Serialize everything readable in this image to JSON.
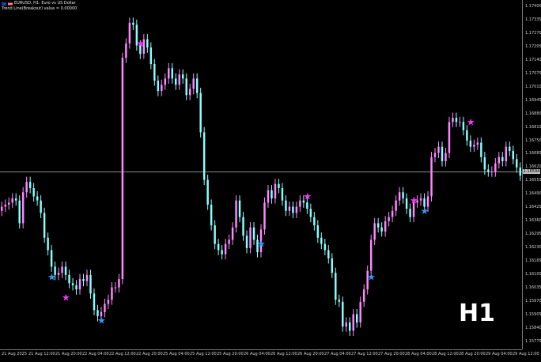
{
  "header": {
    "symbol": "EURUSD, H1:  Euro vs US Dollar",
    "indicator": "Trend Line(Breakout) value = 0.00000"
  },
  "timeframe_badge": "H1",
  "current_price": "1.16594",
  "colors": {
    "background": "#000000",
    "bull_candle": "#ff88ff",
    "bear_candle": "#88ffff",
    "sell_star": "#ff33ff",
    "buy_star": "#3399ff",
    "axis_text": "#cfcfcf",
    "price_line": "#8d8d8d"
  },
  "icons": {
    "sell_signal": "magenta-star-icon",
    "buy_signal": "blue-star-icon"
  },
  "price_axis": {
    "labels": [
      "1.17400",
      "1.17335",
      "1.17270",
      "1.17205",
      "1.17140",
      "1.17075",
      "1.17010",
      "1.16945",
      "1.16880",
      "1.16815",
      "1.16750",
      "1.16685",
      "1.16620",
      "1.16555",
      "1.16490",
      "1.16425",
      "1.16360",
      "1.16295",
      "1.16230",
      "1.16165",
      "1.16100",
      "1.16035",
      "1.15970",
      "1.15905",
      "1.15840",
      "1.15775"
    ]
  },
  "time_axis": {
    "labels": [
      "21 Aug 2025",
      "21 Aug 12:00",
      "21 Aug 20:00",
      "22 Aug 04:00",
      "22 Aug 12:00",
      "22 Aug 20:00",
      "25 Aug 04:00",
      "25 Aug 12:00",
      "25 Aug 20:00",
      "26 Aug 04:00",
      "26 Aug 12:00",
      "26 Aug 20:00",
      "27 Aug 04:00",
      "27 Aug 12:00",
      "27 Aug 20:00",
      "28 Aug 04:00",
      "28 Aug 12:00",
      "28 Aug 20:00",
      "29 Aug 04:00",
      "29 Aug 12:00"
    ]
  },
  "chart_data": {
    "type": "candlestick",
    "symbol": "EURUSD",
    "timeframe": "H1",
    "ylim": [
      1.1574,
      1.1743
    ],
    "candles_close": [
      1.1643,
      1.1644,
      1.1645,
      1.1647,
      1.1646,
      1.1635,
      1.165,
      1.1655,
      1.1652,
      1.1648,
      1.1646,
      1.164,
      1.1628,
      1.1622,
      1.1614,
      1.161,
      1.1611,
      1.1614,
      1.161,
      1.1606,
      1.1605,
      1.1603,
      1.1608,
      1.1607,
      1.161,
      1.1601,
      1.1593,
      1.159,
      1.1592,
      1.1596,
      1.1598,
      1.1604,
      1.1604,
      1.1608,
      1.1715,
      1.1722,
      1.1732,
      1.1731,
      1.1721,
      1.1717,
      1.1724,
      1.172,
      1.1712,
      1.1704,
      1.1699,
      1.1702,
      1.1705,
      1.171,
      1.1705,
      1.1702,
      1.1707,
      1.1705,
      1.1697,
      1.17,
      1.1705,
      1.1698,
      1.1679,
      1.1656,
      1.1644,
      1.1634,
      1.1625,
      1.1622,
      1.162,
      1.1625,
      1.1627,
      1.1633,
      1.1646,
      1.1638,
      1.1629,
      1.1623,
      1.1633,
      1.1627,
      1.1621,
      1.1632,
      1.1645,
      1.1651,
      1.1647,
      1.1654,
      1.1652,
      1.1646,
      1.1641,
      1.1643,
      1.164,
      1.1643,
      1.1646,
      1.1645,
      1.1642,
      1.1638,
      1.1634,
      1.1628,
      1.1625,
      1.1622,
      1.1618,
      1.1611,
      1.1598,
      1.1597,
      1.1585,
      1.1587,
      1.1583,
      1.1591,
      1.1587,
      1.1597,
      1.1603,
      1.1612,
      1.1627,
      1.1635,
      1.1633,
      1.1631,
      1.1636,
      1.1638,
      1.1641,
      1.1646,
      1.165,
      1.1647,
      1.1642,
      1.1638,
      1.1645,
      1.1646,
      1.1647,
      1.1643,
      1.1648,
      1.1667,
      1.1669,
      1.1672,
      1.1665,
      1.1669,
      1.1684,
      1.1686,
      1.1684,
      1.1684,
      1.168,
      1.1675,
      1.1672,
      1.1673,
      1.1674,
      1.1667,
      1.1661,
      1.166,
      1.166,
      1.1664,
      1.1667,
      1.1665,
      1.1672,
      1.167,
      1.1666,
      1.1662,
      1.1658
    ]
  }
}
